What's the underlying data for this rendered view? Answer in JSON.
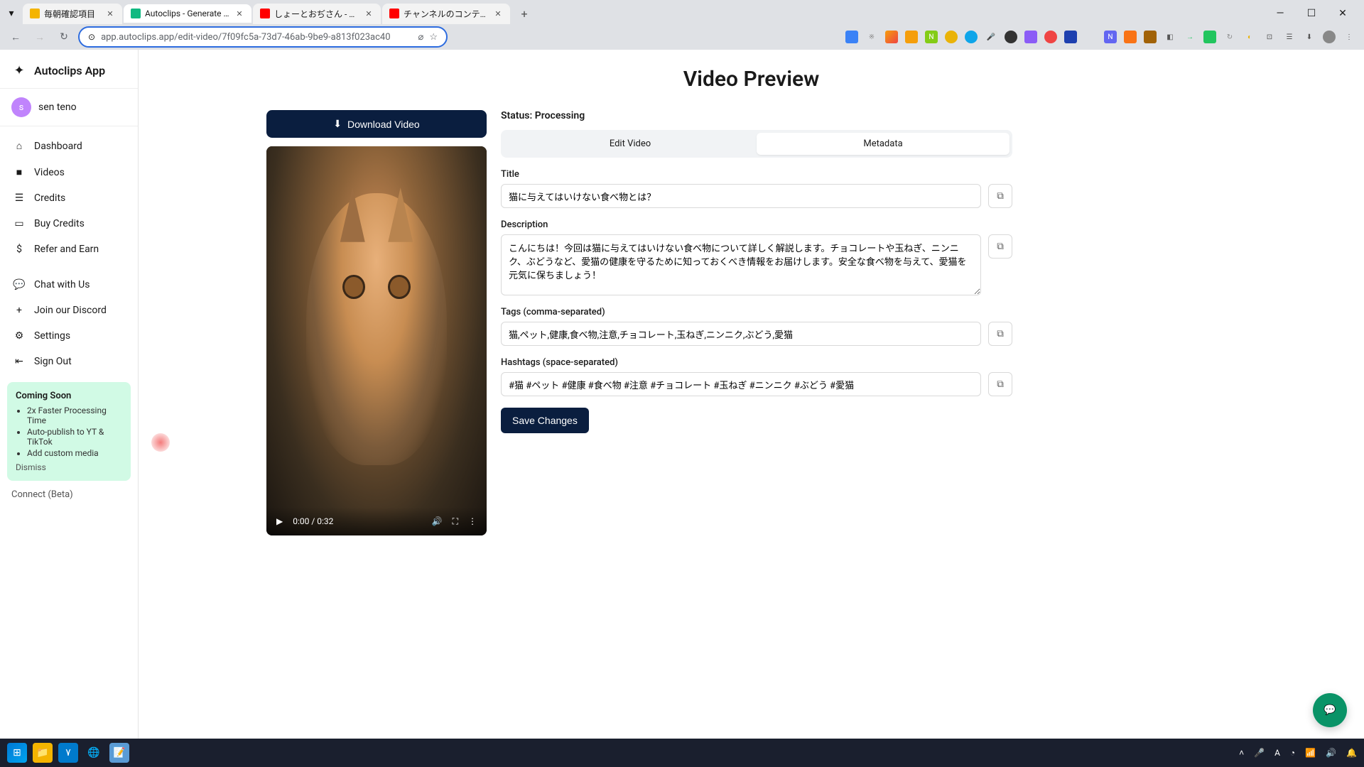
{
  "browser": {
    "tabs": [
      {
        "title": "毎朝確認項目",
        "favicon_color": "#f4b400"
      },
      {
        "title": "Autoclips - Generate Viral TikTo",
        "favicon_color": "#10b981",
        "active": true
      },
      {
        "title": "しょーとおぢさん - YouTube",
        "favicon_color": "#ff0000"
      },
      {
        "title": "チャンネルのコンテンツ - YouTube S",
        "favicon_color": "#ff0000"
      }
    ],
    "url": "app.autoclips.app/edit-video/7f09fc5a-73d7-46ab-9be9-a813f023ac40"
  },
  "app": {
    "name": "Autoclips App",
    "user": {
      "initial": "s",
      "name": "sen teno"
    },
    "nav": {
      "dashboard": "Dashboard",
      "videos": "Videos",
      "credits": "Credits",
      "buy_credits": "Buy Credits",
      "refer": "Refer and Earn",
      "chat": "Chat with Us",
      "discord": "Join our Discord",
      "settings": "Settings",
      "sign_out": "Sign Out"
    },
    "coming_soon": {
      "title": "Coming Soon",
      "items": [
        "2x Faster Processing Time",
        "Auto-publish to YT & TikTok",
        "Add custom media"
      ],
      "dismiss": "Dismiss"
    },
    "connect": "Connect (Beta)"
  },
  "page": {
    "title": "Video Preview",
    "download": "Download Video",
    "video": {
      "time": "0:00 / 0:32"
    },
    "status_label": "Status: Processing",
    "tabs": {
      "edit": "Edit Video",
      "metadata": "Metadata"
    },
    "fields": {
      "title_label": "Title",
      "title_value": "猫に与えてはいけない食べ物とは？",
      "description_label": "Description",
      "description_value": "こんにちは！今回は猫に与えてはいけない食べ物について詳しく解説します。チョコレートや玉ねぎ、ニンニク、ぶどうなど、愛猫の健康を守るために知っておくべき情報をお届けします。安全な食べ物を与えて、愛猫を元気に保ちましょう！",
      "tags_label": "Tags (comma-separated)",
      "tags_value": "猫,ペット,健康,食べ物,注意,チョコレート,玉ねぎ,ニンニク,ぶどう,愛猫",
      "hashtags_label": "Hashtags (space-separated)",
      "hashtags_value": "#猫 #ペット #健康 #食べ物 #注意 #チョコレート #玉ねぎ #ニンニク #ぶどう #愛猫"
    },
    "save": "Save Changes"
  }
}
